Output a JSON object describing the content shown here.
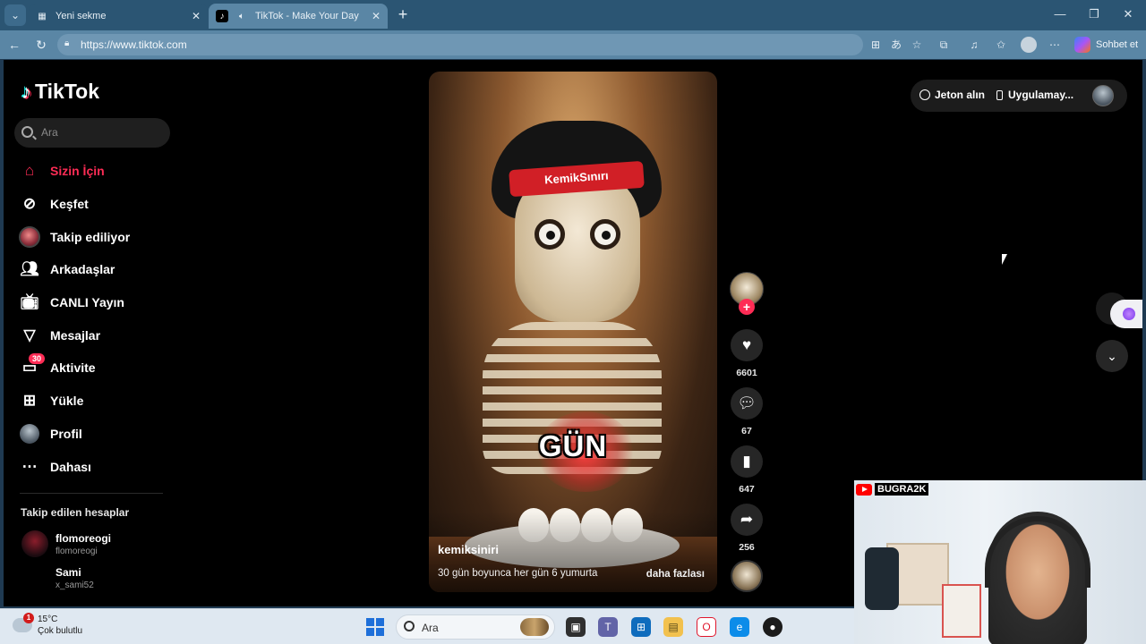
{
  "browser": {
    "tabs": [
      {
        "label": "Yeni sekme",
        "icon": "new-tab-page-icon",
        "active": false
      },
      {
        "label": "TikTok - Make Your Day",
        "icon": "tiktok-icon",
        "active": true
      }
    ],
    "url": "https://www.tiktok.com",
    "copilot_label": "Sohbet et"
  },
  "sidebar": {
    "logo": "TikTok",
    "search_placeholder": "Ara",
    "nav": [
      {
        "label": "Sizin İçin",
        "icon": "home-icon",
        "active": true
      },
      {
        "label": "Keşfet",
        "icon": "compass-icon"
      },
      {
        "label": "Takip ediliyor",
        "icon": "following-avatar-icon"
      },
      {
        "label": "Arkadaşlar",
        "icon": "friends-icon"
      },
      {
        "label": "CANLI Yayın",
        "icon": "live-tv-icon"
      },
      {
        "label": "Mesajlar",
        "icon": "send-icon"
      },
      {
        "label": "Aktivite",
        "icon": "activity-icon",
        "badge": "30"
      },
      {
        "label": "Yükle",
        "icon": "upload-icon"
      },
      {
        "label": "Profil",
        "icon": "profile-avatar-icon"
      },
      {
        "label": "Dahası",
        "icon": "more-icon"
      }
    ],
    "following_title": "Takip edilen hesaplar",
    "following": [
      {
        "name": "flomoreogi",
        "handle": "flomoreogi"
      },
      {
        "name": "Sami",
        "handle": "x_sami52"
      }
    ]
  },
  "video": {
    "headband_text": "KemikSınırı",
    "caption": "GÜN",
    "author": "kemiksiniri",
    "description": "30 gün boyunca her gün 6 yumurta",
    "more_label": "daha fazlası"
  },
  "actions": {
    "likes": "6601",
    "comments": "67",
    "saves": "647",
    "shares": "256"
  },
  "topbar": {
    "coins_label": "Jeton alın",
    "app_label": "Uygulamay..."
  },
  "webcam": {
    "channel": "BUGRA2K"
  },
  "taskbar": {
    "weather_badge": "1",
    "temperature": "15°C",
    "condition": "Çok bulutlu",
    "search_label": "Ara"
  }
}
